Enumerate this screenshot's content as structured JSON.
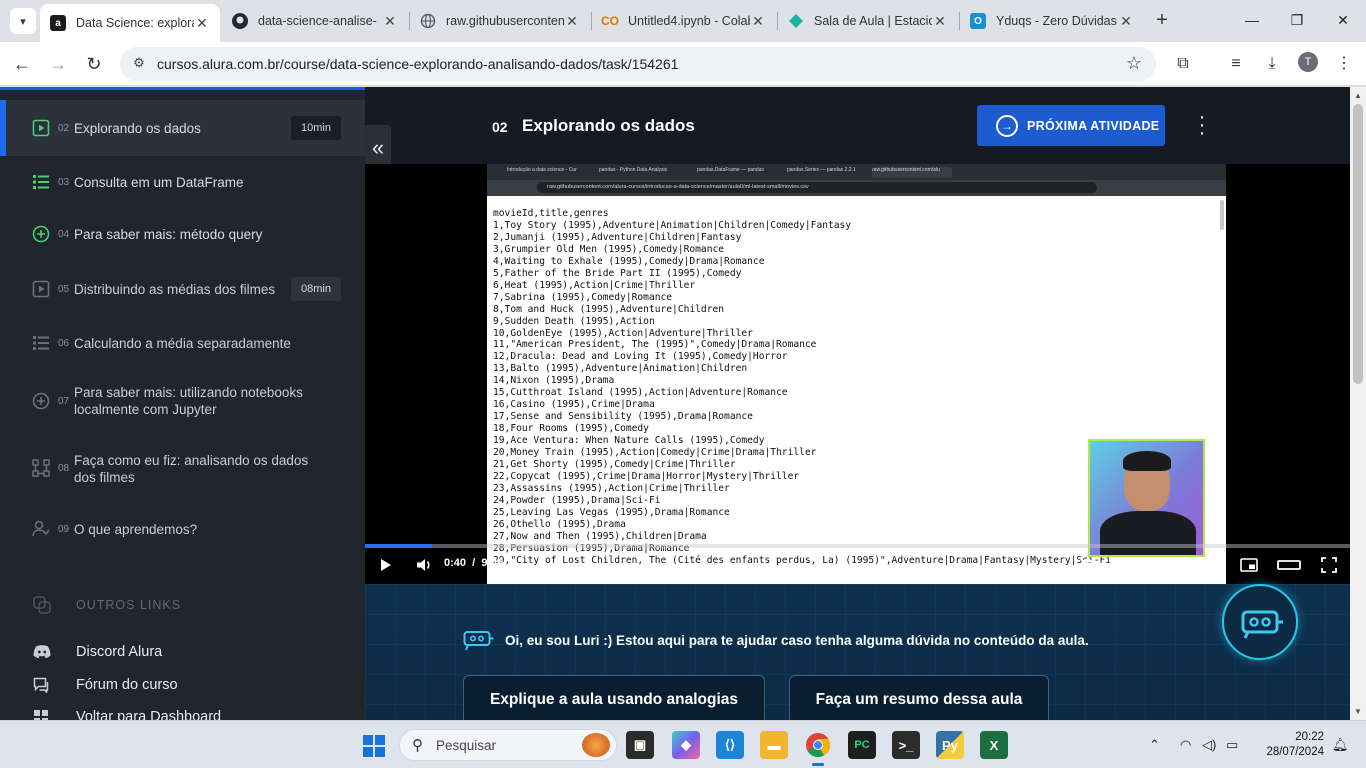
{
  "browser": {
    "tabs": [
      {
        "title": "Data Science: explora",
        "active": true,
        "icon": "alura-icon",
        "color": "#1c1c1c"
      },
      {
        "title": "data-science-analise-",
        "active": false,
        "icon": "github-icon",
        "color": "#24292f"
      },
      {
        "title": "raw.githubusercontent",
        "active": false,
        "icon": "globe-icon",
        "color": "#5f6368"
      },
      {
        "title": "Untitled4.ipynb - Colab",
        "active": false,
        "icon": "colab-icon",
        "color": "#e37400"
      },
      {
        "title": "Sala de Aula | Estacio",
        "active": false,
        "icon": "estacio-icon",
        "color": "#1bb3a4"
      },
      {
        "title": "Yduqs - Zero Dúvidas",
        "active": false,
        "icon": "yduqs-icon",
        "color": "#1a8fd1"
      }
    ],
    "url": "cursos.alura.com.br/course/data-science-explorando-analisando-dados/task/154261",
    "profile_initial": "T"
  },
  "sidebar": {
    "lessons": [
      {
        "num": "02",
        "label": "Explorando os dados",
        "duration": "10min",
        "icon": "video-icon",
        "active": true
      },
      {
        "num": "03",
        "label": "Consulta em um DataFrame",
        "duration": "",
        "icon": "list-icon",
        "active": false
      },
      {
        "num": "04",
        "label": "Para saber mais: método query",
        "duration": "",
        "icon": "plus-circle-icon",
        "active": false
      },
      {
        "num": "05",
        "label": "Distribuindo as médias dos filmes",
        "duration": "08min",
        "icon": "video-icon",
        "active": false
      },
      {
        "num": "06",
        "label": "Calculando a média separadamente",
        "duration": "",
        "icon": "list-icon",
        "active": false
      },
      {
        "num": "07",
        "label": "Para saber mais: utilizando notebooks localmente com Jupyter",
        "duration": "",
        "icon": "plus-circle-icon",
        "active": false
      },
      {
        "num": "08",
        "label": "Faça como eu fiz: analisando os dados dos filmes",
        "duration": "",
        "icon": "hierarchy-icon",
        "active": false
      },
      {
        "num": "09",
        "label": "O que aprendemos?",
        "duration": "",
        "icon": "person-icon",
        "active": false
      }
    ],
    "other_links_title": "OUTROS LINKS",
    "links": [
      {
        "label": "Discord Alura",
        "icon": "discord-icon"
      },
      {
        "label": "Fórum do curso",
        "icon": "forum-icon"
      },
      {
        "label": "Voltar para Dashboard",
        "icon": "dashboard-icon"
      }
    ]
  },
  "header": {
    "number": "02",
    "title": "Explorando os dados",
    "next_button": "PRÓXIMA ATIVIDADE"
  },
  "video": {
    "csv_lines": [
      "movieId,title,genres",
      "1,Toy Story (1995),Adventure|Animation|Children|Comedy|Fantasy",
      "2,Jumanji (1995),Adventure|Children|Fantasy",
      "3,Grumpier Old Men (1995),Comedy|Romance",
      "4,Waiting to Exhale (1995),Comedy|Drama|Romance",
      "5,Father of the Bride Part II (1995),Comedy",
      "6,Heat (1995),Action|Crime|Thriller",
      "7,Sabrina (1995),Comedy|Romance",
      "8,Tom and Huck (1995),Adventure|Children",
      "9,Sudden Death (1995),Action",
      "10,GoldenEye (1995),Action|Adventure|Thriller",
      "11,\"American President, The (1995)\",Comedy|Drama|Romance",
      "12,Dracula: Dead and Loving It (1995),Comedy|Horror",
      "13,Balto (1995),Adventure|Animation|Children",
      "14,Nixon (1995),Drama",
      "15,Cutthroat Island (1995),Action|Adventure|Romance",
      "16,Casino (1995),Crime|Drama",
      "17,Sense and Sensibility (1995),Drama|Romance",
      "18,Four Rooms (1995),Comedy",
      "19,Ace Ventura: When Nature Calls (1995),Comedy",
      "20,Money Train (1995),Action|Comedy|Crime|Drama|Thriller",
      "21,Get Shorty (1995),Comedy|Crime|Thriller",
      "22,Copycat (1995),Crime|Drama|Horror|Mystery|Thriller",
      "23,Assassins (1995),Action|Crime|Thriller",
      "24,Powder (1995),Drama|Sci-Fi",
      "25,Leaving Las Vegas (1995),Drama|Romance",
      "26,Othello (1995),Drama",
      "27,Now and Then (1995),Children|Drama",
      "28,Persuasion (1995),Drama|Romance",
      "29,\"City of Lost Children, The (Cité des enfants perdus, La) (1995)\",Adventure|Drama|Fantasy|Mystery|Sci-Fi"
    ],
    "inner_tabs": [
      "Introdução a data science - Cur",
      "pandas - Python Data Analysis",
      "pandas.DataFrame — pandas",
      "pandas.Series — pandas 2.2.1",
      "raw.githubusercontent.com/alu"
    ],
    "inner_url": "raw.githubusercontent.com/alura-cursos/introducao-a-data-science/master/aula0/ml-latest-small/movies.csv",
    "current_time": "0:40",
    "separator": "/",
    "duration": "9:46",
    "progress": 0.068,
    "playback_rate": "1x"
  },
  "luri": {
    "message": "Oi, eu sou Luri :) Estou aqui para te ajudar caso tenha alguma dúvida no conteúdo da aula.",
    "suggestions": [
      "Explique a aula usando analogias",
      "Faça um resumo dessa aula"
    ]
  },
  "taskbar": {
    "search_placeholder": "Pesquisar",
    "time": "20:22",
    "date": "28/07/2024"
  },
  "colors": {
    "accent": "#1c5bd0",
    "sidebar_bg": "#20252e",
    "page_bg": "#151b25",
    "luri_border": "#27c5e8"
  }
}
